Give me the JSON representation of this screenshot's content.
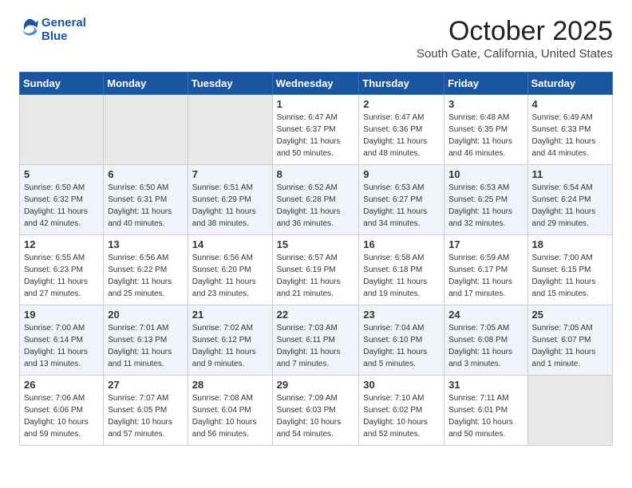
{
  "header": {
    "logo_line1": "General",
    "logo_line2": "Blue",
    "month_title": "October 2025",
    "location": "South Gate, California, United States"
  },
  "days_of_week": [
    "Sunday",
    "Monday",
    "Tuesday",
    "Wednesday",
    "Thursday",
    "Friday",
    "Saturday"
  ],
  "weeks": [
    [
      {
        "day": "",
        "info": ""
      },
      {
        "day": "",
        "info": ""
      },
      {
        "day": "",
        "info": ""
      },
      {
        "day": "1",
        "info": "Sunrise: 6:47 AM\nSunset: 6:37 PM\nDaylight: 11 hours and 50 minutes."
      },
      {
        "day": "2",
        "info": "Sunrise: 6:47 AM\nSunset: 6:36 PM\nDaylight: 11 hours and 48 minutes."
      },
      {
        "day": "3",
        "info": "Sunrise: 6:48 AM\nSunset: 6:35 PM\nDaylight: 11 hours and 46 minutes."
      },
      {
        "day": "4",
        "info": "Sunrise: 6:49 AM\nSunset: 6:33 PM\nDaylight: 11 hours and 44 minutes."
      }
    ],
    [
      {
        "day": "5",
        "info": "Sunrise: 6:50 AM\nSunset: 6:32 PM\nDaylight: 11 hours and 42 minutes."
      },
      {
        "day": "6",
        "info": "Sunrise: 6:50 AM\nSunset: 6:31 PM\nDaylight: 11 hours and 40 minutes."
      },
      {
        "day": "7",
        "info": "Sunrise: 6:51 AM\nSunset: 6:29 PM\nDaylight: 11 hours and 38 minutes."
      },
      {
        "day": "8",
        "info": "Sunrise: 6:52 AM\nSunset: 6:28 PM\nDaylight: 11 hours and 36 minutes."
      },
      {
        "day": "9",
        "info": "Sunrise: 6:53 AM\nSunset: 6:27 PM\nDaylight: 11 hours and 34 minutes."
      },
      {
        "day": "10",
        "info": "Sunrise: 6:53 AM\nSunset: 6:25 PM\nDaylight: 11 hours and 32 minutes."
      },
      {
        "day": "11",
        "info": "Sunrise: 6:54 AM\nSunset: 6:24 PM\nDaylight: 11 hours and 29 minutes."
      }
    ],
    [
      {
        "day": "12",
        "info": "Sunrise: 6:55 AM\nSunset: 6:23 PM\nDaylight: 11 hours and 27 minutes."
      },
      {
        "day": "13",
        "info": "Sunrise: 6:56 AM\nSunset: 6:22 PM\nDaylight: 11 hours and 25 minutes."
      },
      {
        "day": "14",
        "info": "Sunrise: 6:56 AM\nSunset: 6:20 PM\nDaylight: 11 hours and 23 minutes."
      },
      {
        "day": "15",
        "info": "Sunrise: 6:57 AM\nSunset: 6:19 PM\nDaylight: 11 hours and 21 minutes."
      },
      {
        "day": "16",
        "info": "Sunrise: 6:58 AM\nSunset: 6:18 PM\nDaylight: 11 hours and 19 minutes."
      },
      {
        "day": "17",
        "info": "Sunrise: 6:59 AM\nSunset: 6:17 PM\nDaylight: 11 hours and 17 minutes."
      },
      {
        "day": "18",
        "info": "Sunrise: 7:00 AM\nSunset: 6:15 PM\nDaylight: 11 hours and 15 minutes."
      }
    ],
    [
      {
        "day": "19",
        "info": "Sunrise: 7:00 AM\nSunset: 6:14 PM\nDaylight: 11 hours and 13 minutes."
      },
      {
        "day": "20",
        "info": "Sunrise: 7:01 AM\nSunset: 6:13 PM\nDaylight: 11 hours and 11 minutes."
      },
      {
        "day": "21",
        "info": "Sunrise: 7:02 AM\nSunset: 6:12 PM\nDaylight: 11 hours and 9 minutes."
      },
      {
        "day": "22",
        "info": "Sunrise: 7:03 AM\nSunset: 6:11 PM\nDaylight: 11 hours and 7 minutes."
      },
      {
        "day": "23",
        "info": "Sunrise: 7:04 AM\nSunset: 6:10 PM\nDaylight: 11 hours and 5 minutes."
      },
      {
        "day": "24",
        "info": "Sunrise: 7:05 AM\nSunset: 6:08 PM\nDaylight: 11 hours and 3 minutes."
      },
      {
        "day": "25",
        "info": "Sunrise: 7:05 AM\nSunset: 6:07 PM\nDaylight: 11 hours and 1 minute."
      }
    ],
    [
      {
        "day": "26",
        "info": "Sunrise: 7:06 AM\nSunset: 6:06 PM\nDaylight: 10 hours and 59 minutes."
      },
      {
        "day": "27",
        "info": "Sunrise: 7:07 AM\nSunset: 6:05 PM\nDaylight: 10 hours and 57 minutes."
      },
      {
        "day": "28",
        "info": "Sunrise: 7:08 AM\nSunset: 6:04 PM\nDaylight: 10 hours and 56 minutes."
      },
      {
        "day": "29",
        "info": "Sunrise: 7:09 AM\nSunset: 6:03 PM\nDaylight: 10 hours and 54 minutes."
      },
      {
        "day": "30",
        "info": "Sunrise: 7:10 AM\nSunset: 6:02 PM\nDaylight: 10 hours and 52 minutes."
      },
      {
        "day": "31",
        "info": "Sunrise: 7:11 AM\nSunset: 6:01 PM\nDaylight: 10 hours and 50 minutes."
      },
      {
        "day": "",
        "info": ""
      }
    ]
  ]
}
